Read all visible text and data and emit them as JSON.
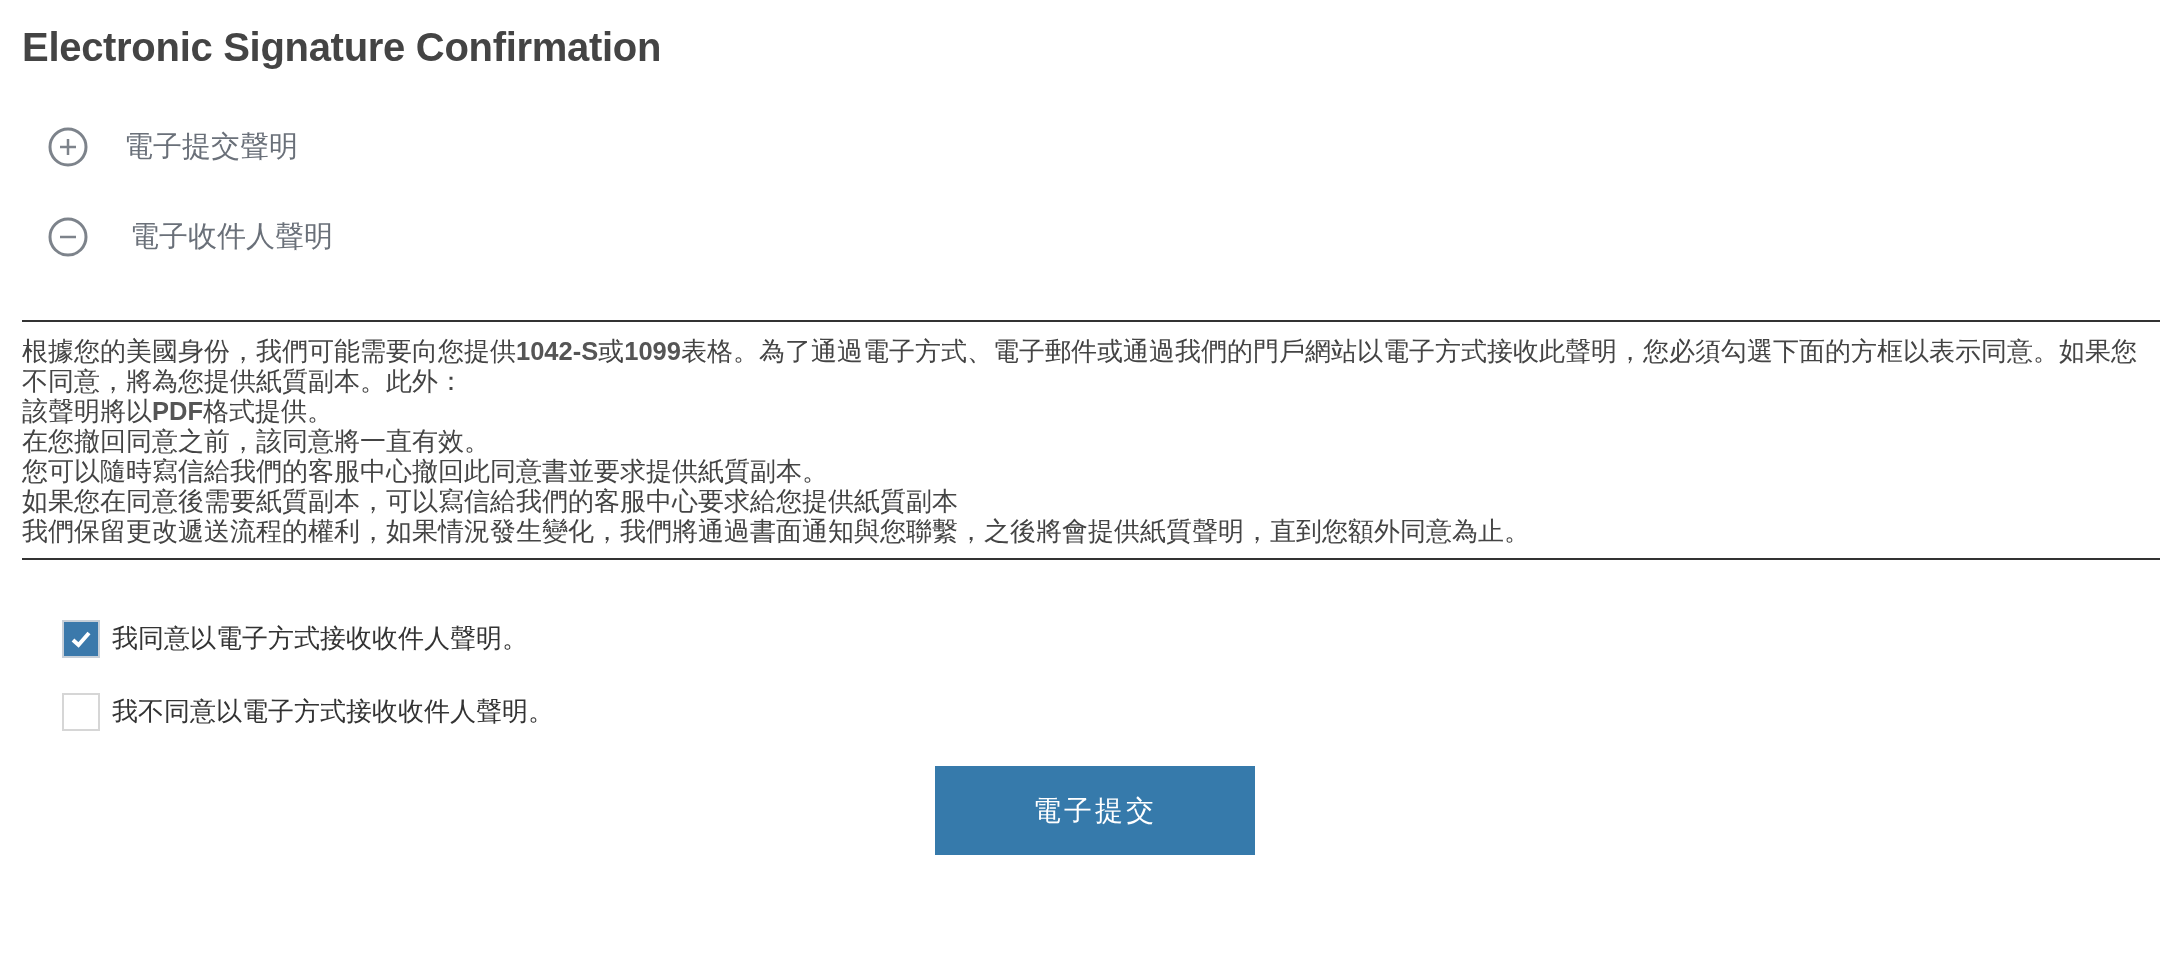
{
  "title": "Electronic Signature Confirmation",
  "sections": [
    {
      "label": "電子提交聲明",
      "expanded": false
    },
    {
      "label": "電子收件人聲明",
      "expanded": true
    }
  ],
  "statement": {
    "intro": "根據您的美國身份，我們可能需要向您提供**1042-S**或**1099**表格。為了通過電子方式、電子郵件或通過我們的門戶網站以電子方式接收此聲明，您必須勾選下面的方框以表示同意。如果您不同意，將為您提供紙質副本。此外：",
    "lines": [
      "該聲明將以**PDF**格式提供。",
      "在您撤回同意之前，該同意將一直有效。",
      "您可以隨時寫信給我們的客服中心撤回此同意書並要求提供紙質副本。",
      "如果您在同意後需要紙質副本，可以寫信給我們的客服中心要求給您提供紙質副本",
      "我們保留更改遞送流程的權利，如果情況發生變化，我們將通過書面通知與您聯繫，之後將會提供紙質聲明，直到您額外同意為止。"
    ]
  },
  "options": [
    {
      "label": "我同意以電子方式接收收件人聲明。",
      "checked": true
    },
    {
      "label": "我不同意以電子方式接收收件人聲明。",
      "checked": false
    }
  ],
  "submit_button": "電子提交"
}
